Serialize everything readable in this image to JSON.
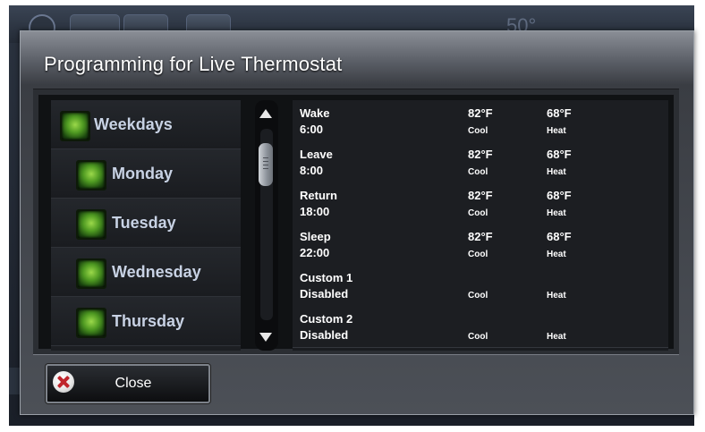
{
  "background": {
    "temperature_text": "50°"
  },
  "dialog": {
    "title": "Programming for Live Thermostat"
  },
  "days": [
    {
      "label": "Weekdays",
      "checked": true
    },
    {
      "label": "Monday",
      "checked": true
    },
    {
      "label": "Tuesday",
      "checked": true
    },
    {
      "label": "Wednesday",
      "checked": true
    },
    {
      "label": "Thursday",
      "checked": true
    }
  ],
  "schedule": [
    {
      "name": "Wake",
      "time": "6:00",
      "cool_temp": "82°F",
      "cool_label": "Cool",
      "heat_temp": "68°F",
      "heat_label": "Heat"
    },
    {
      "name": "Leave",
      "time": "8:00",
      "cool_temp": "82°F",
      "cool_label": "Cool",
      "heat_temp": "68°F",
      "heat_label": "Heat"
    },
    {
      "name": "Return",
      "time": "18:00",
      "cool_temp": "82°F",
      "cool_label": "Cool",
      "heat_temp": "68°F",
      "heat_label": "Heat"
    },
    {
      "name": "Sleep",
      "time": "22:00",
      "cool_temp": "82°F",
      "cool_label": "Cool",
      "heat_temp": "68°F",
      "heat_label": "Heat"
    },
    {
      "name": "Custom 1",
      "time": "Disabled",
      "cool_temp": "",
      "cool_label": "Cool",
      "heat_temp": "",
      "heat_label": "Heat"
    },
    {
      "name": "Custom 2",
      "time": "Disabled",
      "cool_temp": "",
      "cool_label": "Cool",
      "heat_temp": "",
      "heat_label": "Heat"
    }
  ],
  "footer": {
    "close_label": "Close"
  },
  "icons": {
    "close": "close-icon",
    "scroll_up": "scroll-up-arrow-icon",
    "scroll_down": "scroll-down-arrow-icon",
    "day_check": "checkbox-icon"
  },
  "colors": {
    "check_green": "#4f9a22",
    "close_red": "#c0262d",
    "day_text": "#c8d2e4"
  }
}
